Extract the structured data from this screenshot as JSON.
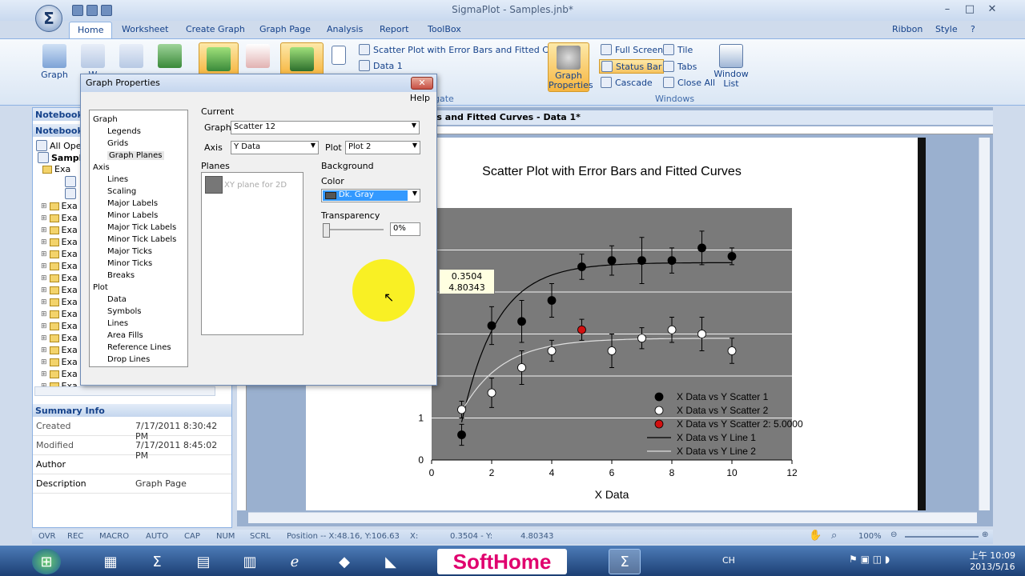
{
  "window": {
    "title": "SigmaPlot - Samples.jnb*"
  },
  "ribbon": {
    "tabs": [
      "Home",
      "Worksheet",
      "Create Graph",
      "Graph Page",
      "Analysis",
      "Report",
      "ToolBox"
    ],
    "right_items": {
      "ribbon": "Ribbon",
      "style": "Style"
    },
    "graph_btn": "Graph",
    "graph_sub": "W",
    "recent_graphs": [
      "Scatter Plot with Error Bars and Fitted Curves",
      "Data 1"
    ],
    "group_partial": "gate",
    "graph_properties": "Graph Properties",
    "window_items": {
      "full_screen": "Full Screen",
      "tile": "Tile",
      "status_bar": "Status Bar",
      "tabs": "Tabs",
      "cascade": "Cascade",
      "close_all": "Close All",
      "window_list": "Window List"
    },
    "windows_group": "Windows"
  },
  "notebook": {
    "header": "Notebook M",
    "subheader": "Notebook",
    "items": [
      "All Oper",
      "Sampl",
      "Exa"
    ],
    "summary_header": "Summary Info",
    "summary": [
      {
        "k": "Created",
        "v": "7/17/2011 8:30:42 PM"
      },
      {
        "k": "Modified",
        "v": "7/17/2011 8:45:02 PM"
      },
      {
        "k": "Author",
        "v": ""
      },
      {
        "k": "Description",
        "v": "Graph Page"
      }
    ]
  },
  "doc_tab": "rs and Fitted Curves - Data 1*",
  "dialog": {
    "title": "Graph Properties",
    "help": "Help",
    "current": "Current",
    "graph_label": "Graph",
    "graph_value": "Scatter 12",
    "axis_label": "Axis",
    "axis_value": "Y Data",
    "plot_label": "Plot",
    "plot_value": "Plot 2",
    "planes": "Planes",
    "plane_item": "XY plane for 2D",
    "background": "Background",
    "color_label": "Color",
    "color_value": "Dk. Gray",
    "transparency": "Transparency",
    "transparency_value": "0%",
    "nav": [
      {
        "t": "Graph",
        "lvl": 0
      },
      {
        "t": "Legends",
        "lvl": 1
      },
      {
        "t": "Grids",
        "lvl": 1
      },
      {
        "t": "Graph Planes",
        "lvl": 1,
        "sel": true
      },
      {
        "t": "Axis",
        "lvl": 0
      },
      {
        "t": "Lines",
        "lvl": 1
      },
      {
        "t": "Scaling",
        "lvl": 1
      },
      {
        "t": "Major Labels",
        "lvl": 1
      },
      {
        "t": "Minor Labels",
        "lvl": 1
      },
      {
        "t": "Major Tick Labels",
        "lvl": 1
      },
      {
        "t": "Minor Tick Labels",
        "lvl": 1
      },
      {
        "t": "Major Ticks",
        "lvl": 1
      },
      {
        "t": "Minor Ticks",
        "lvl": 1
      },
      {
        "t": "Breaks",
        "lvl": 1
      },
      {
        "t": "Plot",
        "lvl": 0
      },
      {
        "t": "Data",
        "lvl": 1
      },
      {
        "t": "Symbols",
        "lvl": 1
      },
      {
        "t": "Lines",
        "lvl": 1
      },
      {
        "t": "Area Fills",
        "lvl": 1
      },
      {
        "t": "Reference Lines",
        "lvl": 1
      },
      {
        "t": "Drop Lines",
        "lvl": 1
      }
    ]
  },
  "tooltip": {
    "l1": "0.3504",
    "l2": "4.80343"
  },
  "chart_data": {
    "type": "scatter",
    "title": "Scatter Plot with Error Bars and Fitted Curves",
    "xlabel": "X Data",
    "ylabel": "",
    "xlim": [
      0,
      12
    ],
    "ylim": [
      0,
      6
    ],
    "xticks": [
      0,
      2,
      4,
      6,
      8,
      10,
      12
    ],
    "yticks_visible": [
      0,
      1
    ],
    "plane_color": "#7a7a7a",
    "series": [
      {
        "name": "X Data vs Y Scatter 1",
        "color": "#000000",
        "x": [
          1,
          2,
          3,
          4,
          5,
          6,
          7,
          8,
          9,
          10
        ],
        "y": [
          0.6,
          3.2,
          3.3,
          3.8,
          4.6,
          4.75,
          4.75,
          4.75,
          5.05,
          4.85
        ],
        "err": [
          0.25,
          0.45,
          0.5,
          0.4,
          0.3,
          0.35,
          0.55,
          0.3,
          0.4,
          0.2
        ]
      },
      {
        "name": "X Data vs Y Scatter 2",
        "color": "#ffffff",
        "x": [
          1,
          2,
          3,
          4,
          5,
          6,
          7,
          8,
          9,
          10
        ],
        "y": [
          1.2,
          1.6,
          2.2,
          2.6,
          3.1,
          2.6,
          2.9,
          3.1,
          3.0,
          2.6
        ],
        "err": [
          0.2,
          0.35,
          0.4,
          0.25,
          0.25,
          0.4,
          0.25,
          0.3,
          0.4,
          0.3
        ],
        "highlight_index": 4,
        "highlight_color": "#d21010"
      }
    ],
    "legend": [
      {
        "label": "X Data vs Y Scatter 1",
        "kind": "dot",
        "color": "#000000"
      },
      {
        "label": "X Data vs Y Scatter 2",
        "kind": "dot",
        "color": "#ffffff"
      },
      {
        "label": "X Data vs Y Scatter 2: 5.0000",
        "kind": "dot",
        "color": "#d21010"
      },
      {
        "label": "X Data vs Y Line 1",
        "kind": "line",
        "color": "#000000"
      },
      {
        "label": "X Data vs Y Line 2",
        "kind": "line",
        "color": "#dddddd"
      }
    ],
    "legend_position": "bottom-right"
  },
  "statusbar": {
    "ovr": "OVR",
    "rec": "REC",
    "macro": "MACRO",
    "auto": "AUTO",
    "cap": "CAP",
    "num": "NUM",
    "scrl": "SCRL",
    "position": "Position -- X:48.16, Y:106.63",
    "x_label": "X:",
    "xy_value": "0.3504 - Y:",
    "y_value": "4.80343",
    "zoom": "100%"
  },
  "taskbar": {
    "brand": "SoftHome",
    "time": "上午 10:09",
    "date": "2013/5/16",
    "lang": "CH"
  }
}
